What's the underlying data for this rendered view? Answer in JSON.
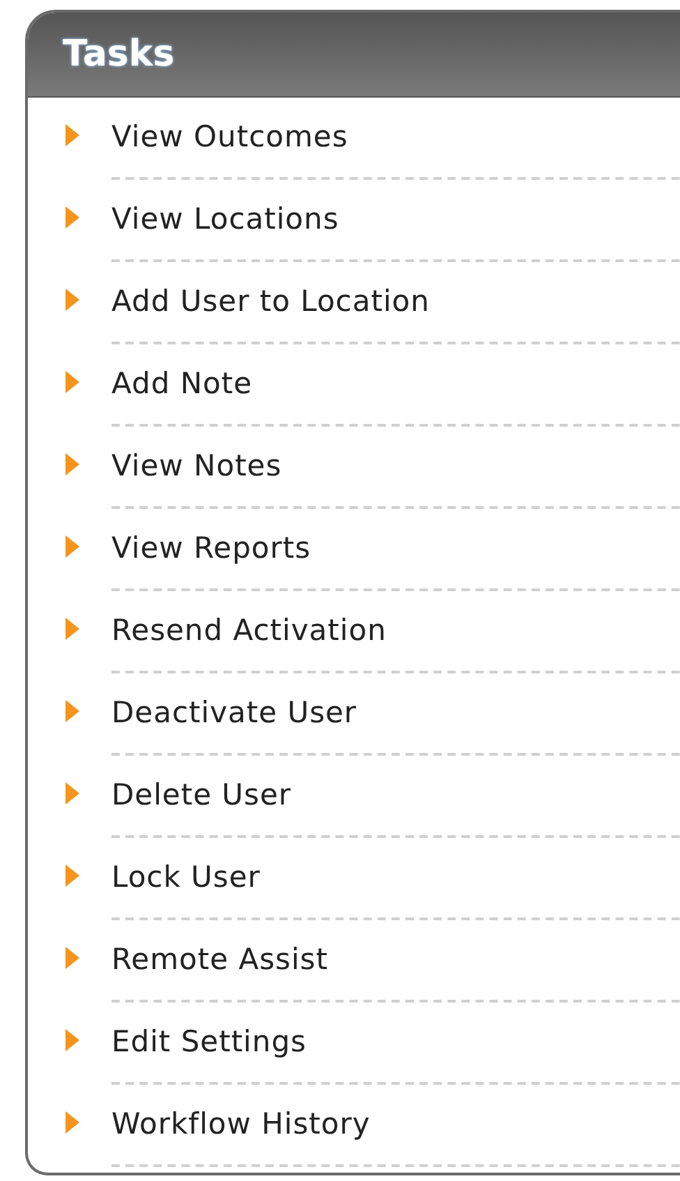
{
  "panel": {
    "title": "Tasks",
    "items": [
      {
        "label": "View Outcomes"
      },
      {
        "label": "View Locations"
      },
      {
        "label": "Add User to Location"
      },
      {
        "label": "Add Note"
      },
      {
        "label": "View Notes"
      },
      {
        "label": "View Reports"
      },
      {
        "label": "Resend Activation"
      },
      {
        "label": "Deactivate User"
      },
      {
        "label": "Delete User"
      },
      {
        "label": "Lock User"
      },
      {
        "label": "Remote Assist"
      },
      {
        "label": "Edit Settings"
      },
      {
        "label": "Workflow History"
      }
    ]
  }
}
